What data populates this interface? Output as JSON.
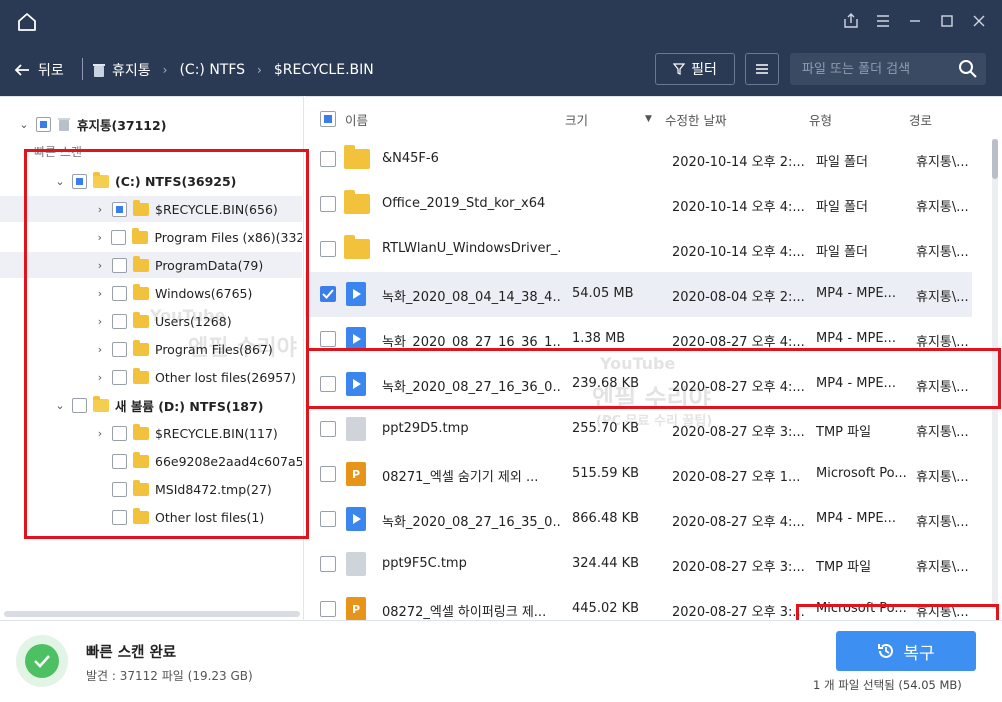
{
  "header": {
    "toolbar": {
      "back_label": "뒤로",
      "breadcrumbs": [
        "휴지통",
        "(C:) NTFS",
        "$RECYCLE.BIN"
      ],
      "filter_label": "필터",
      "search_placeholder": "파일 또는 폴더 검색"
    }
  },
  "tree": {
    "root": {
      "label": "휴지통(37112)"
    },
    "quick_scan_label": "빠른 스캔",
    "items": [
      {
        "label": "(C:) NTFS(36925)"
      },
      {
        "label": "$RECYCLE.BIN(656)"
      },
      {
        "label": "Program Files (x86)(332)"
      },
      {
        "label": "ProgramData(79)"
      },
      {
        "label": "Windows(6765)"
      },
      {
        "label": "Users(1268)"
      },
      {
        "label": "Program Files(867)"
      },
      {
        "label": "Other lost files(26957)"
      },
      {
        "label": "새 볼륨 (D:) NTFS(187)"
      },
      {
        "label": "$RECYCLE.BIN(117)"
      },
      {
        "label": "66e9208e2aad4c607a52..."
      },
      {
        "label": "MSId8472.tmp(27)"
      },
      {
        "label": "Other lost files(1)"
      }
    ]
  },
  "list": {
    "columns": {
      "name": "이름",
      "size": "크기",
      "modified": "수정한 날짜",
      "type": "유형",
      "path": "경로"
    },
    "rows": [
      {
        "name": "&N45F-6",
        "size": "",
        "date": "2020-10-14 오후 2:...",
        "type": "파일 폴더",
        "path": "휴지통\\...",
        "icon": "folder-icon",
        "checked": false
      },
      {
        "name": "Office_2019_Std_kor_x64",
        "size": "",
        "date": "2020-10-14 오후 4:...",
        "type": "파일 폴더",
        "path": "휴지통\\...",
        "icon": "folder-icon",
        "checked": false
      },
      {
        "name": "RTLWlanU_WindowsDriver_...",
        "size": "",
        "date": "2020-10-14 오후 4:...",
        "type": "파일 폴더",
        "path": "휴지통\\...",
        "icon": "folder-icon",
        "checked": false
      },
      {
        "name": "녹화_2020_08_04_14_38_4...",
        "size": "54.05 MB",
        "date": "2020-08-04 오후 2:...",
        "type": "MP4 - MPE...",
        "path": "휴지통\\...",
        "icon": "video-file-icon",
        "checked": true
      },
      {
        "name": "녹화_2020_08_27_16_36_1...",
        "size": "1.38 MB",
        "date": "2020-08-27 오후 4:...",
        "type": "MP4 - MPE...",
        "path": "휴지통\\...",
        "icon": "video-file-icon",
        "checked": false
      },
      {
        "name": "녹화_2020_08_27_16_36_0...",
        "size": "239.68 KB",
        "date": "2020-08-27 오후 4:...",
        "type": "MP4 - MPE...",
        "path": "휴지통\\...",
        "icon": "video-file-icon",
        "checked": false
      },
      {
        "name": "ppt29D5.tmp",
        "size": "255.70 KB",
        "date": "2020-08-27 오후 3:...",
        "type": "TMP 파일",
        "path": "휴지통\\...",
        "icon": "tmp-file-icon",
        "checked": false
      },
      {
        "name": "08271_엑셀 숨기기 제외 ...",
        "size": "515.59 KB",
        "date": "2020-08-27 오후 1...",
        "type": "Microsoft Po...",
        "path": "휴지통\\...",
        "icon": "powerpoint-file-icon",
        "checked": false
      },
      {
        "name": "녹화_2020_08_27_16_35_0...",
        "size": "866.48 KB",
        "date": "2020-08-27 오후 4:...",
        "type": "MP4 - MPE...",
        "path": "휴지통\\...",
        "icon": "video-file-icon",
        "checked": false
      },
      {
        "name": "ppt9F5C.tmp",
        "size": "324.44 KB",
        "date": "2020-08-27 오후 3:...",
        "type": "TMP 파일",
        "path": "휴지통\\...",
        "icon": "tmp-file-icon",
        "checked": false
      },
      {
        "name": "08272_엑셀 하이퍼링크 제...",
        "size": "445.02 KB",
        "date": "2020-08-27 오후 3:...",
        "type": "Microsoft Po...",
        "path": "휴지통\\...",
        "icon": "powerpoint-file-icon",
        "checked": false
      }
    ]
  },
  "status": {
    "title": "빠른 스캔 완료",
    "found": "발견 : 37112 파일 (19.23 GB)",
    "recover_label": "복구",
    "selected": "1 개 파일 선택됨 (54.05 MB)"
  },
  "watermark": {
    "line1": "YouTube",
    "line2": "엔필 수리야",
    "line3": "(PC 무료 수리 꿀팁)"
  },
  "colors": {
    "titlebar_bg": "#2a3a54",
    "accent": "#3d8ff2",
    "highlight_border": "#e0141a",
    "success": "#4cc063"
  }
}
